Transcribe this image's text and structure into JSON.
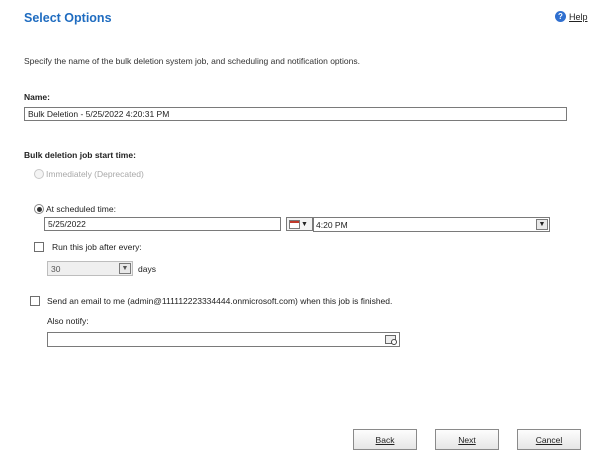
{
  "header": {
    "title": "Select Options",
    "help_label": "Help"
  },
  "description": "Specify the name of the bulk deletion system job, and scheduling and notification options.",
  "name_field": {
    "label": "Name:",
    "value": "Bulk Deletion - 5/25/2022 4:20:31 PM"
  },
  "start_time": {
    "label": "Bulk deletion job start time:",
    "immediately_label": "Immediately (Deprecated)",
    "scheduled_label": "At scheduled time:",
    "date_value": "5/25/2022",
    "time_value": "4:20 PM"
  },
  "recurrence": {
    "label": "Run this job after every:",
    "interval_value": "30",
    "unit_label": "days"
  },
  "notification": {
    "email_label": "Send an email to me (admin@111112223334444.onmicrosoft.com) when this job is finished.",
    "also_notify_label": "Also notify:",
    "also_notify_value": ""
  },
  "buttons": {
    "back": "Back",
    "next": "Next",
    "cancel": "Cancel"
  },
  "icons": {
    "help": "help-icon",
    "calendar": "calendar-icon",
    "lookup": "lookup-icon",
    "dropdown": "chevron-down-icon"
  }
}
